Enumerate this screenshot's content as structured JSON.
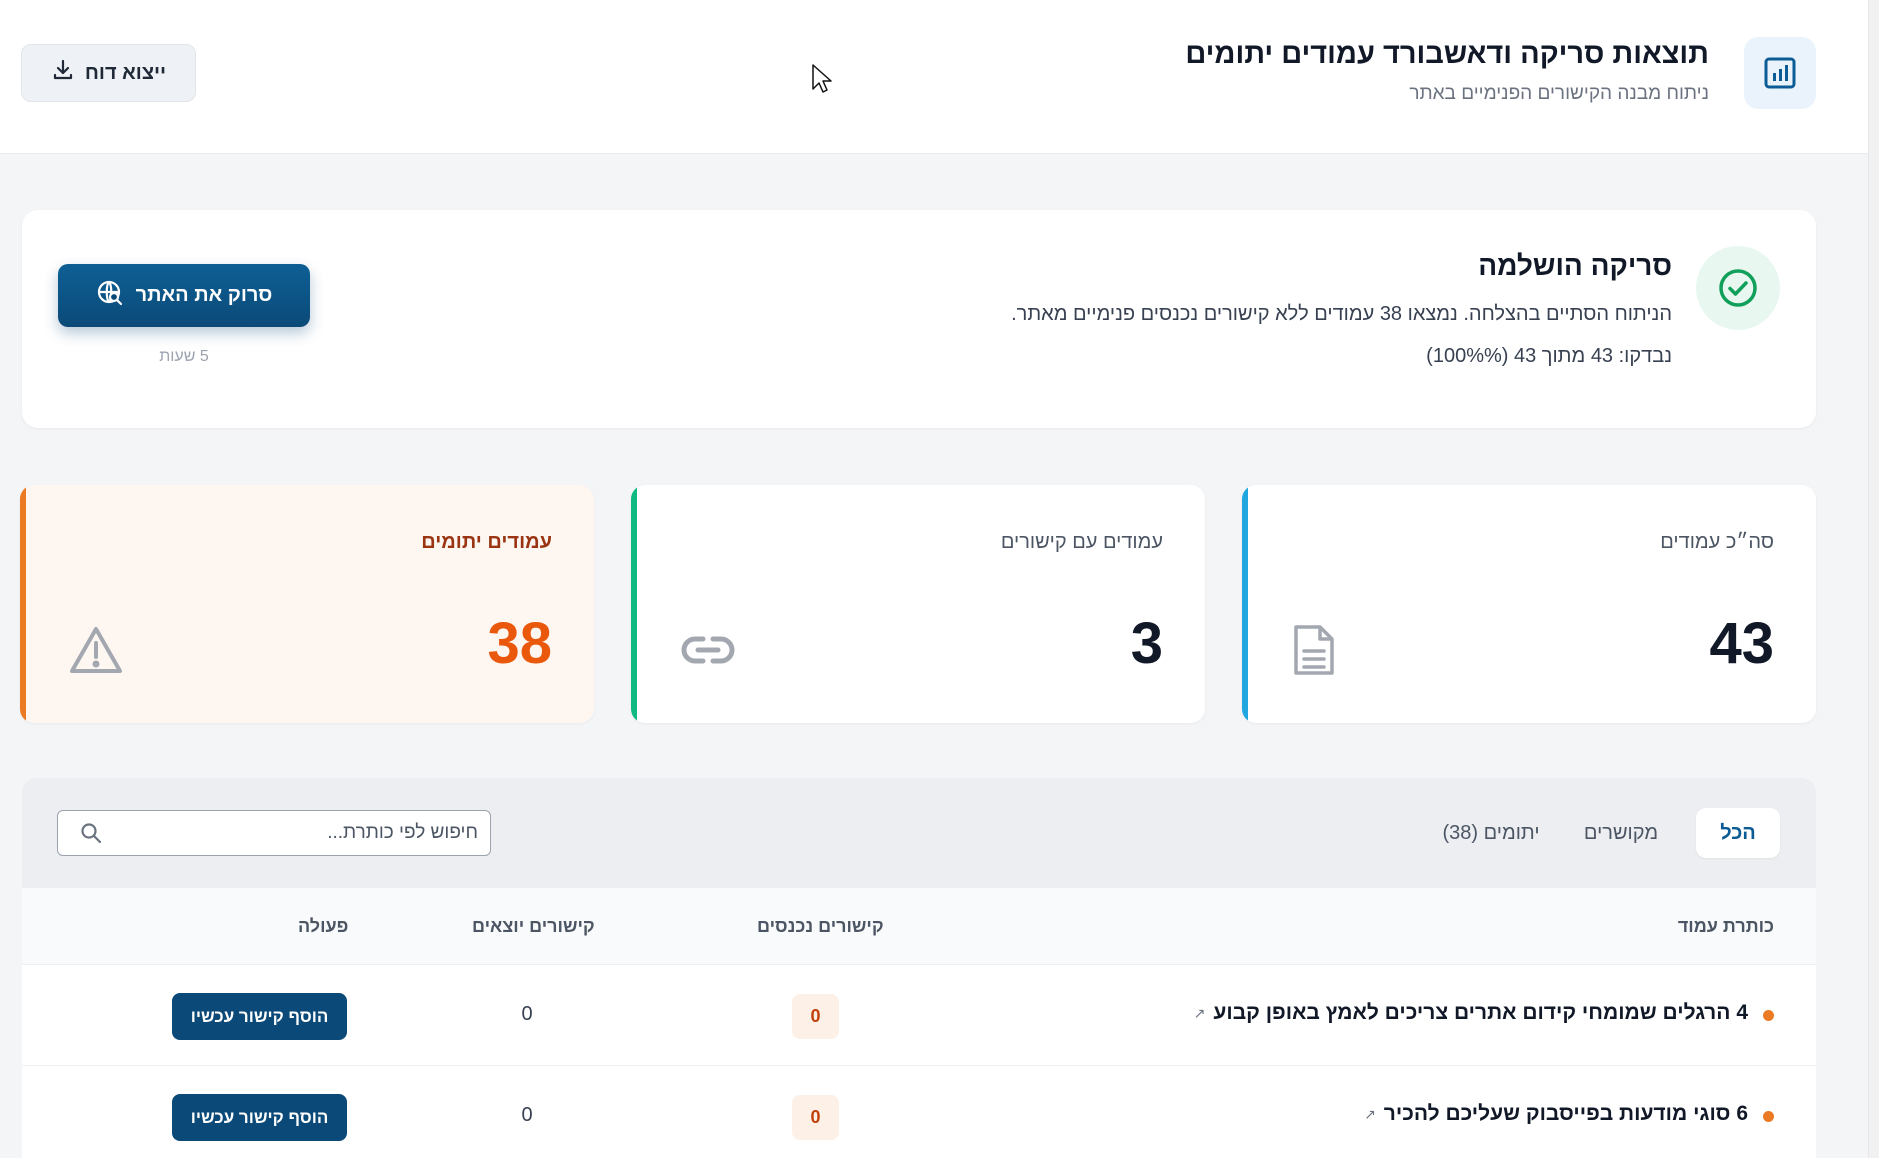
{
  "header": {
    "title": "תוצאות סריקה ודאשבורד עמודים יתומים",
    "subtitle": "ניתוח מבנה הקישורים הפנימיים באתר",
    "export_label": "ייצוא דוח",
    "icon": "bar-chart-icon"
  },
  "scan": {
    "title": "סריקה הושלמה",
    "message": "הניתוח הסתיים בהצלחה. נמצאו 38 עמודים ללא קישורים נכנסים פנימיים מאתר.",
    "progress": "נבדקו: 43 מתוך 43 (100%%)",
    "button_label": "סרוק את האתר",
    "time_ago": "5 שעות",
    "status_icon": "check-circle-icon"
  },
  "stats": [
    {
      "label": "סה״כ עמודים",
      "value": "43",
      "icon": "document-icon",
      "color": "#22a6e0"
    },
    {
      "label": "עמודים עם קישורים",
      "value": "3",
      "icon": "link-icon",
      "color": "#10b981"
    },
    {
      "label": "עמודים יתומים",
      "value": "38",
      "icon": "warning-icon",
      "color": "#ea7a23"
    }
  ],
  "filters": {
    "tabs": [
      "הכל",
      "מקושרים",
      "יתומים (38)"
    ],
    "active": "הכל",
    "search_placeholder": "חיפוש לפי כותרת..."
  },
  "table": {
    "columns": [
      "כותרת עמוד",
      "קישורים נכנסים",
      "קישורים יוצאים",
      "פעולה"
    ],
    "rows": [
      {
        "title": "4 הרגלים שמומחי קידום אתרים צריכים לאמץ באופן קבוע",
        "incoming": "0",
        "outgoing": "0",
        "action": "הוסף קישור עכשיו"
      },
      {
        "title": "6 סוגי מודעות בפייסבוק שעליכם להכיר",
        "incoming": "0",
        "outgoing": "0",
        "action": "הוסף קישור עכשיו"
      }
    ]
  }
}
